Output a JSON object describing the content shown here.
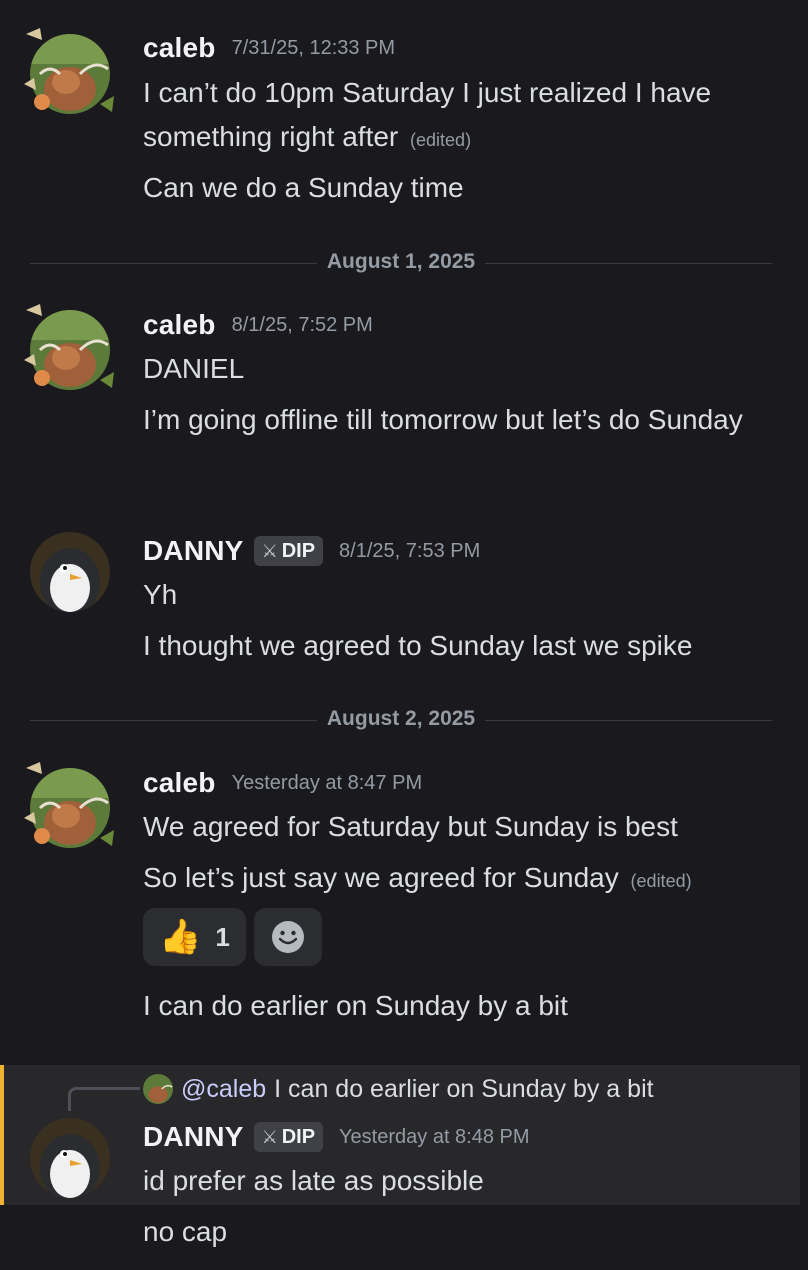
{
  "messages": {
    "m1": {
      "username": "caleb",
      "timestamp": "7/31/25, 12:33 PM",
      "lines": [
        "I can’t do 10pm Saturday I just realized I have something right after",
        "Can we do a Sunday time"
      ],
      "edited": "(edited)"
    },
    "divider1": "August 1, 2025",
    "m2": {
      "username": "caleb",
      "timestamp": "8/1/25, 7:52 PM",
      "lines": [
        "DANIEL",
        "I’m going offline till tomorrow but let’s do Sunday"
      ]
    },
    "m3": {
      "username": "DANNY",
      "tag": "DIP",
      "timestamp": "8/1/25, 7:53 PM",
      "lines": [
        "Yh",
        "I thought we agreed to Sunday last we spike"
      ]
    },
    "divider2": "August 2, 2025",
    "m4": {
      "username": "caleb",
      "timestamp": "Yesterday at 8:47 PM",
      "lines": [
        "We agreed for Saturday but Sunday is best",
        "So let’s just say we agreed for Sunday",
        "I can do earlier on Sunday by a bit"
      ],
      "edited": "(edited)",
      "reaction": {
        "emoji": "👍",
        "count": "1"
      }
    },
    "m5": {
      "reply_mention": "@caleb",
      "reply_text": "I can do earlier on Sunday by a bit",
      "username": "DANNY",
      "tag": "DIP",
      "timestamp": "Yesterday at 8:48 PM",
      "lines": [
        "id prefer as late as possible",
        "no cap"
      ]
    }
  },
  "icons": {
    "add_reaction": "smiley-add-reaction-icon",
    "tag_icon": "sword-icon",
    "caleb_avatar": "highland-cow-avatar",
    "danny_avatar": "penguin-avatar"
  },
  "colors": {
    "background": "#1a1a1e",
    "reply_highlight": "#28272a",
    "reply_accent": "#f0b232",
    "mention": "#c9cdfb"
  }
}
